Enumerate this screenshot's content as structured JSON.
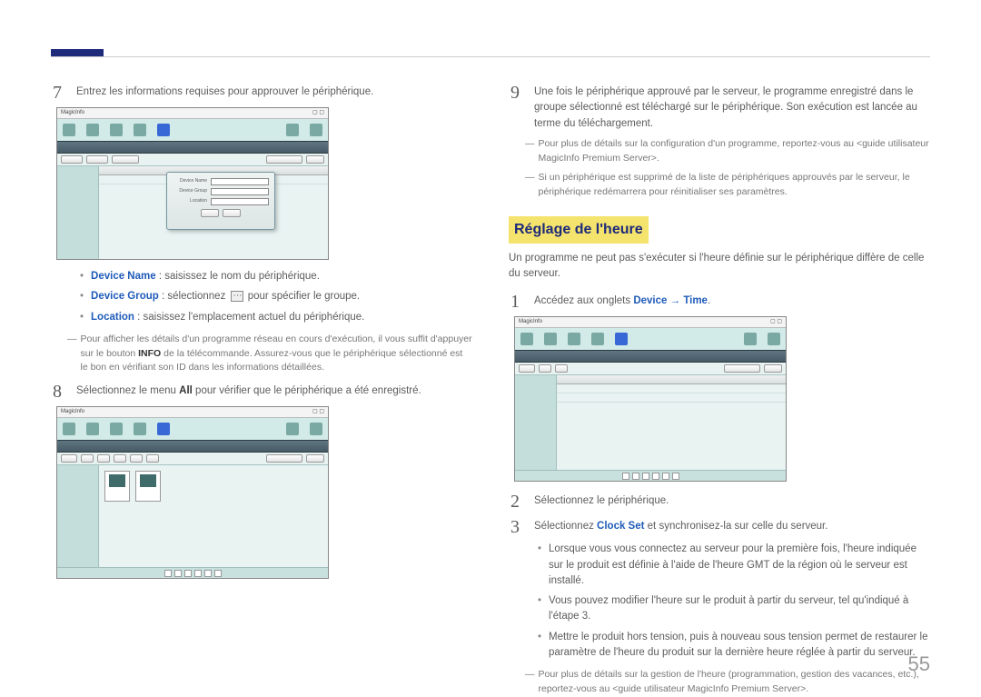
{
  "page_number": "55",
  "left": {
    "step7": {
      "num": "7",
      "text": "Entrez les informations requises pour approuver le périphérique."
    },
    "bullets": {
      "device_name_label": "Device Name",
      "device_name_text": " : saisissez le nom du périphérique.",
      "device_group_label": "Device Group",
      "device_group_pre": " : sélectionnez ",
      "device_group_post": " pour spécifier le groupe.",
      "location_label": "Location",
      "location_text": " : saisissez l'emplacement actuel du périphérique."
    },
    "note1": "Pour afficher les détails d'un programme réseau en cours d'exécution, il vous suffit d'appuyer sur le bouton INFO de la télécommande. Assurez-vous que le périphérique sélectionné est le bon en vérifiant son ID dans les informations détaillées.",
    "note1_info": "INFO",
    "step8": {
      "num": "8",
      "pre": "Sélectionnez le menu ",
      "bold": "All",
      "post": " pour vérifier que le périphérique a été enregistré."
    },
    "screenshot_brand": "MagicInfo"
  },
  "right": {
    "step9": {
      "num": "9",
      "text": "Une fois le périphérique approuvé par le serveur, le programme enregistré dans le groupe sélectionné est téléchargé sur le périphérique. Son exécution est lancée au terme du téléchargement."
    },
    "note_a": "Pour plus de détails sur la configuration d'un programme, reportez-vous au <guide utilisateur MagicInfo Premium Server>.",
    "note_b": "Si un périphérique est supprimé de la liste de périphériques approuvés par le serveur, le périphérique redémarrera pour réinitialiser ses paramètres.",
    "heading": "Réglage de l'heure",
    "intro": "Un programme ne peut pas s'exécuter si l'heure définie sur le périphérique diffère de celle du serveur.",
    "step1": {
      "num": "1",
      "pre": "Accédez aux onglets ",
      "device": "Device",
      "arrow": " → ",
      "time": "Time",
      "post": "."
    },
    "step2": {
      "num": "2",
      "text": "Sélectionnez le périphérique."
    },
    "step3": {
      "num": "3",
      "pre": "Sélectionnez ",
      "clockset": "Clock Set",
      "post": " et synchronisez-la sur celle du serveur."
    },
    "bullet1": "Lorsque vous vous connectez au serveur pour la première fois, l'heure indiquée sur le produit est définie à l'aide de l'heure GMT de la région où le serveur est installé.",
    "bullet2": "Vous pouvez modifier l'heure sur le produit à partir du serveur, tel qu'indiqué à l'étape 3.",
    "bullet3": "Mettre le produit hors tension, puis à nouveau sous tension permet de restaurer le paramètre de l'heure du produit sur la dernière heure réglée à partir du serveur.",
    "note_c": "Pour plus de détails sur la gestion de l'heure (programmation, gestion des vacances, etc.), reportez-vous au <guide utilisateur MagicInfo Premium Server>."
  }
}
